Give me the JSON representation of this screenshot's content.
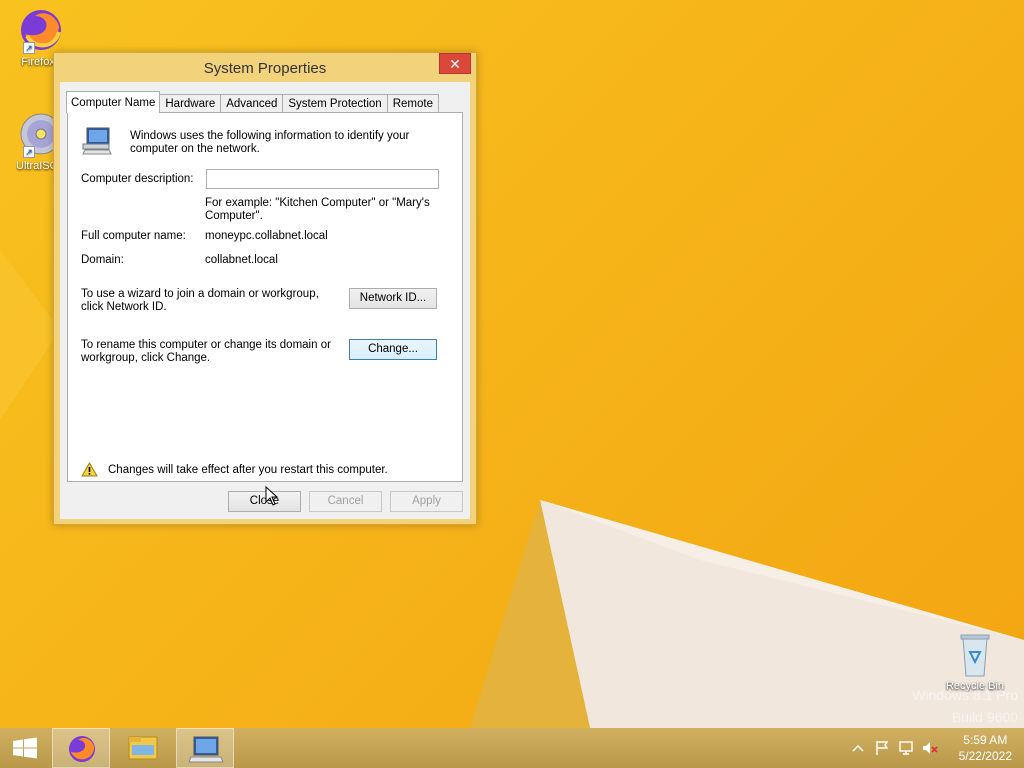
{
  "desktop": {
    "icons": [
      {
        "label": "Firefox"
      },
      {
        "label": "UltraISO"
      },
      {
        "label": "Recycle Bin"
      }
    ],
    "watermark": {
      "line1": "Windows 8.1 Pro",
      "line2": "Build 9600"
    }
  },
  "dialog": {
    "title": "System Properties",
    "close_glyph": "✕",
    "tabs": [
      {
        "label": "Computer Name",
        "active": true
      },
      {
        "label": "Hardware"
      },
      {
        "label": "Advanced"
      },
      {
        "label": "System Protection"
      },
      {
        "label": "Remote"
      }
    ],
    "intro_text": "Windows uses the following information to identify your computer on the network.",
    "description_label": "Computer description:",
    "description_value": "",
    "example_text": "For example: \"Kitchen Computer\" or \"Mary's Computer\".",
    "full_name_label": "Full computer name:",
    "full_name_value": "moneypc.collabnet.local",
    "domain_label": "Domain:",
    "domain_value": "collabnet.local",
    "network_id_text": "To use a wizard to join a domain or workgroup, click Network ID.",
    "network_id_button": "Network ID...",
    "rename_text": "To rename this computer or change its domain or workgroup, click Change.",
    "change_button": "Change...",
    "warning_text": "Changes will take effect after you restart this computer.",
    "buttons": {
      "close": "Close",
      "cancel": "Cancel",
      "apply": "Apply"
    }
  },
  "taskbar": {
    "time": "5:59 AM",
    "date": "5/22/2022"
  },
  "colors": {
    "desktop": "#f6b519",
    "window_frame": "#f3d27c",
    "close_button": "#d9483b",
    "taskbar": "#c9a955"
  }
}
